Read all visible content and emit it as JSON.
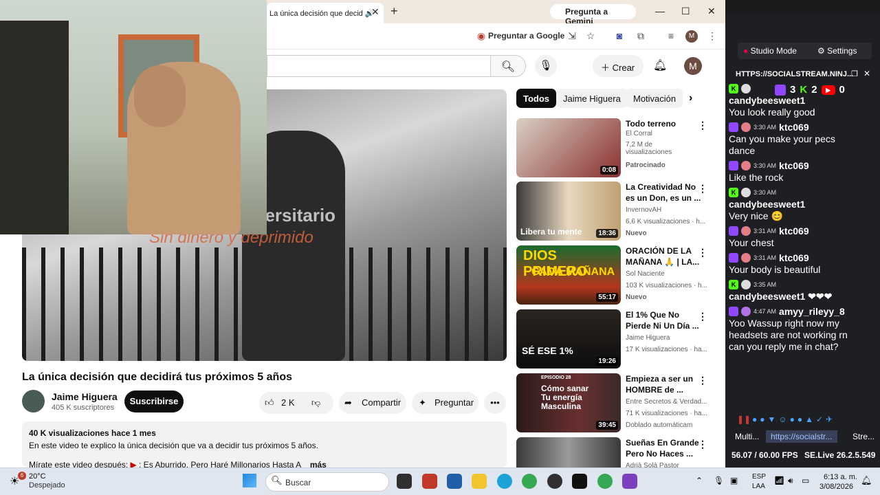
{
  "browser": {
    "tab_title": "La única decisión que decid",
    "gemini_label": "Pregunta a Gemini",
    "ask_google": "Preguntar a Google",
    "profile_letter": "M"
  },
  "yt": {
    "create_label": "Crear",
    "avatar_letter": "M",
    "video_overlay_1": "universitario",
    "video_overlay_2": "Sin dinero y deprimido",
    "title": "La única decisión que decidirá tus próximos 5 años",
    "channel": "Jaime Higuera",
    "subs": "405 K suscriptores",
    "subscribe": "Suscribirse",
    "likes": "2 K",
    "share": "Compartir",
    "ask": "Preguntar",
    "views_date": "40 K visualizaciones  hace 1 mes",
    "desc_line1": "En este video te explico la única decisión que va a decidir tus próximos 5 años.",
    "desc_line2": "Mírate este video después:",
    "desc_line2_link": ": Es Aburrido, Pero Haré Millonarios Hasta A",
    "desc_more": "más",
    "chips": [
      "Todos",
      "Jaime Higuera",
      "Motivación"
    ],
    "recs": [
      {
        "title": "Todo terreno",
        "channel": "El Corral",
        "views": "7,2 M de visualizaciones",
        "badge": "Patrocinado",
        "duration": "0:08",
        "thumb_text": ""
      },
      {
        "title": "La Creatividad No es un Don, es un ...",
        "channel": "InvernovAH",
        "views": "6,6 K visualizaciones · h...",
        "badge": "Nuevo",
        "duration": "18:36",
        "thumb_text": "Libera tu mente"
      },
      {
        "title": "ORACIÓN DE LA MAÑANA 🙏 | LA...",
        "channel": "Sol Naciente",
        "views": "103 K visualizaciones · h...",
        "badge": "Nuevo",
        "duration": "55:17",
        "thumb_text": "DIOS PRIMERO"
      },
      {
        "title": "El 1% Que No Pierde Ni Un Día ...",
        "channel": "Jaime Higuera",
        "views": "17 K visualizaciones · ha...",
        "badge": "",
        "duration": "19:26",
        "thumb_text": "SÉ ESE 1%"
      },
      {
        "title": "Empieza a ser un HOMBRE de ...",
        "channel": "Entre Secretos & Verdad...",
        "views": "71 K visualizaciones · ha...",
        "badge": "Doblado automáticam",
        "duration": "39:45",
        "thumb_text": "Cómo sanar Tu energía Masculina"
      },
      {
        "title": "Sueñas En Grande Pero No Haces ...",
        "channel": "Adrià Solà Pastor",
        "views": "",
        "badge": "",
        "duration": "",
        "thumb_text": ""
      }
    ],
    "dios_sub": "CADA MAÑANA",
    "episodio": "EPISODIO 28"
  },
  "ss": {
    "studio_mode": "Studio Mode",
    "settings": "Settings",
    "header_url": "HTTPS://SOCIALSTREAM.NINJ...",
    "counts": {
      "twitch": "3",
      "kick": "2",
      "youtube": "0"
    },
    "messages": [
      {
        "platform": "kick",
        "time": "",
        "name": "candybeesweet1",
        "text": "You look really good"
      },
      {
        "platform": "twitch",
        "time": "3:30 AM",
        "name": "ktc069",
        "text": "Can you make your pecs dance"
      },
      {
        "platform": "twitch",
        "time": "3:30 AM",
        "name": "ktc069",
        "text": "Like the rock"
      },
      {
        "platform": "kick",
        "time": "3:30 AM",
        "name": "candybeesweet1",
        "text": "Very nice 😊"
      },
      {
        "platform": "twitch",
        "time": "3:31 AM",
        "name": "ktc069",
        "text": "Your chest"
      },
      {
        "platform": "twitch",
        "time": "3:31 AM",
        "name": "ktc069",
        "text": "Your body is beautiful"
      },
      {
        "platform": "kick",
        "time": "3:35 AM",
        "name": "candybeesweet1 ❤❤❤",
        "text": ""
      },
      {
        "platform": "twitch",
        "time": "4:47 AM",
        "name": "amyy_rileyy_8",
        "text": "Yoo Wassup right now my headsets are not working rn can you reply me in chat?"
      }
    ],
    "tabs": [
      "Multi...",
      "https://socialstr...",
      "Stre..."
    ],
    "fps": "56.07 / 60.00 FPS",
    "version": "SE.Live 26.2.5.549"
  },
  "taskbar": {
    "temp": "20°C",
    "weather": "Despejado",
    "notif_count": "6",
    "search": "Buscar",
    "lang1": "ESP",
    "lang2": "LAA",
    "time": "6:13 a. m.",
    "date": "3/08/2026"
  },
  "colors": {
    "twitch": "#9146ff",
    "kick": "#53fc18",
    "youtube": "#ff0000",
    "yt_black": "#0f0f0f"
  }
}
